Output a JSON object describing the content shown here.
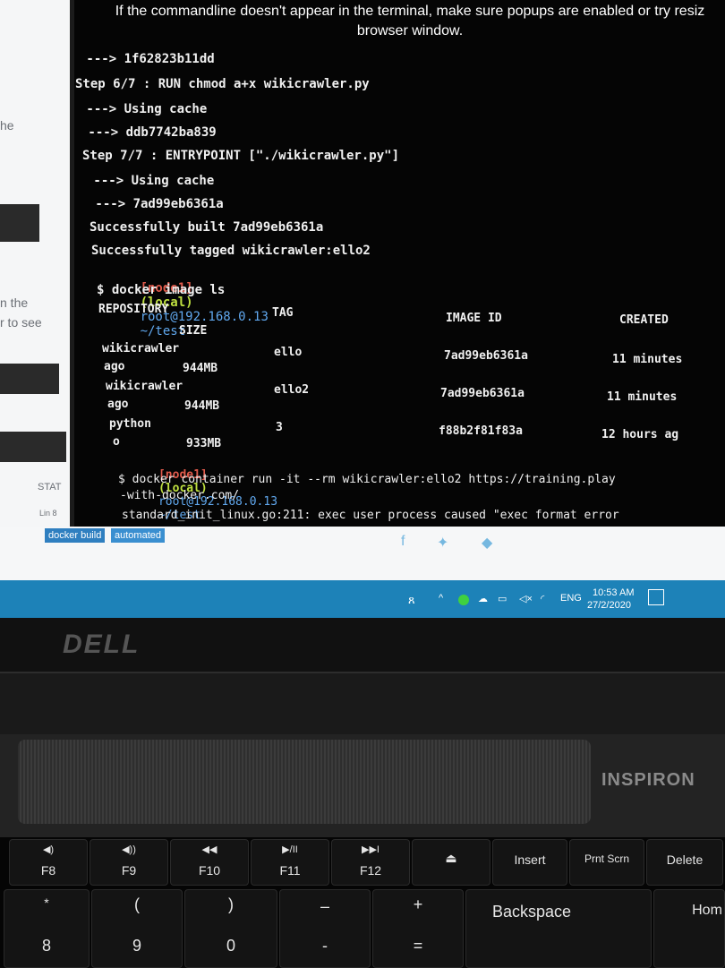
{
  "sidebar": {
    "frag1": "he",
    "frag2": "n the",
    "frag3": "r to see",
    "stat_label": "STAT",
    "frag4": "Lin 8"
  },
  "terminal": {
    "notice_line1": "If the commandline doesn't appear in the terminal, make sure popups are enabled or try resiz",
    "notice_line2": "browser window.",
    "lines": [
      " ---> 1f62823b11dd",
      "Step 6/7 : RUN chmod a+x wikicrawler.py",
      " ---> Using cache",
      " ---> ddb7742ba839",
      "Step 7/7 : ENTRYPOINT [\"./wikicrawler.py\"]",
      " ---> Using cache",
      " ---> 7ad99eb6361a",
      "Successfully built 7ad99eb6361a",
      "Successfully tagged wikicrawler:ello2"
    ],
    "prompt1": {
      "node": "[node1]",
      "local": "(local)",
      "host": "root@192.168.0.13",
      "path": "~/test"
    },
    "cmd1": "$ docker image ls",
    "table_header": {
      "repository": "REPOSITORY",
      "tag": "TAG",
      "image_id": "IMAGE ID",
      "created": "CREATED",
      "size": "SIZE"
    },
    "rows": [
      {
        "repo": "wikicrawler",
        "tag": "ello",
        "id": "7ad99eb6361a",
        "created": "11 minutes",
        "wrap": "ago",
        "size": "944MB"
      },
      {
        "repo": "wikicrawler",
        "tag": "ello2",
        "id": "7ad99eb6361a",
        "created": "11 minutes",
        "wrap": "ago",
        "size": "944MB"
      },
      {
        "repo": "python",
        "tag": "3",
        "id": "f88b2f81f83a",
        "created": "12 hours ag",
        "wrap": "o",
        "size": "933MB"
      }
    ],
    "prompt2": {
      "node": "[node1]",
      "local": "(local)",
      "host": "root@192.168.0.13",
      "path": "~/test"
    },
    "cmd2_line1": "$ docker container run -it --rm wikicrawler:ello2 https://training.play",
    "cmd2_line2": "-with-docker.com/",
    "error_line": "standard_init_linux.go:211: exec user process caused \"exec format error"
  },
  "toolbar": {
    "tag1": "docker build",
    "tag2": "automated",
    "social": [
      "facebook-icon",
      "twitter-icon",
      "thumbs-up-icon"
    ]
  },
  "taskbar": {
    "lang": "ENG",
    "time": "10:53 AM",
    "date": "27/2/2020"
  },
  "laptop": {
    "logo": "DELL",
    "brand": "INSPIRON"
  },
  "keyboard": {
    "fkeys": [
      {
        "label": "F8",
        "glyph": "◀)"
      },
      {
        "label": "F9",
        "glyph": "◀))"
      },
      {
        "label": "F10",
        "glyph": "◀◀"
      },
      {
        "label": "F11",
        "glyph": "▶/II"
      },
      {
        "label": "F12",
        "glyph": "▶▶I"
      },
      {
        "label": "",
        "glyph": "⏏"
      },
      {
        "label": "Insert",
        "glyph": ""
      },
      {
        "label": "Prnt Scrn",
        "glyph": ""
      },
      {
        "label": "Delete",
        "glyph": ""
      }
    ],
    "numrow": [
      {
        "top": "*",
        "bottom": "8"
      },
      {
        "top": "(",
        "bottom": "9"
      },
      {
        "top": ")",
        "bottom": "0"
      },
      {
        "top": "–",
        "bottom": "-"
      },
      {
        "top": "+",
        "bottom": "="
      },
      {
        "top": "Backspace",
        "bottom": ""
      },
      {
        "top": "Hom",
        "bottom": ""
      }
    ]
  }
}
